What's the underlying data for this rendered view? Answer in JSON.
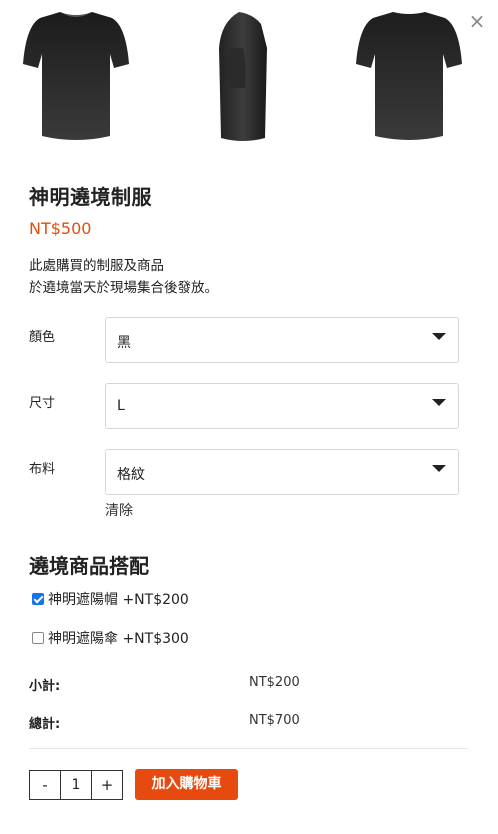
{
  "close_label": "×",
  "product": {
    "title": "神明遶境制服",
    "price": "NT$500",
    "desc_line1": "此處購買的制服及商品",
    "desc_line2": "於遶境當天於現場集合後發放。",
    "images": [
      "tshirt-front-icon",
      "tshirt-side-icon",
      "tshirt-back-icon"
    ]
  },
  "options": {
    "color": {
      "label": "顏色",
      "value": "黑"
    },
    "size": {
      "label": "尺寸",
      "value": "L"
    },
    "fabric": {
      "label": "布料",
      "value": "格紋"
    },
    "clear_label": "清除"
  },
  "addons": {
    "title": "遶境商品搭配",
    "items": [
      {
        "label": "神明遮陽帽 +NT$200",
        "checked": true
      },
      {
        "label": "神明遮陽傘 +NT$300",
        "checked": false
      }
    ]
  },
  "summary": {
    "subtotal_label": "小計:",
    "subtotal_value": "NT$200",
    "total_label": "總計:",
    "total_value": "NT$700"
  },
  "cart": {
    "minus": "-",
    "quantity": "1",
    "plus": "+",
    "add_label": "加入購物車"
  },
  "colors": {
    "accent": "#e64a0f",
    "price": "#e04e10"
  }
}
